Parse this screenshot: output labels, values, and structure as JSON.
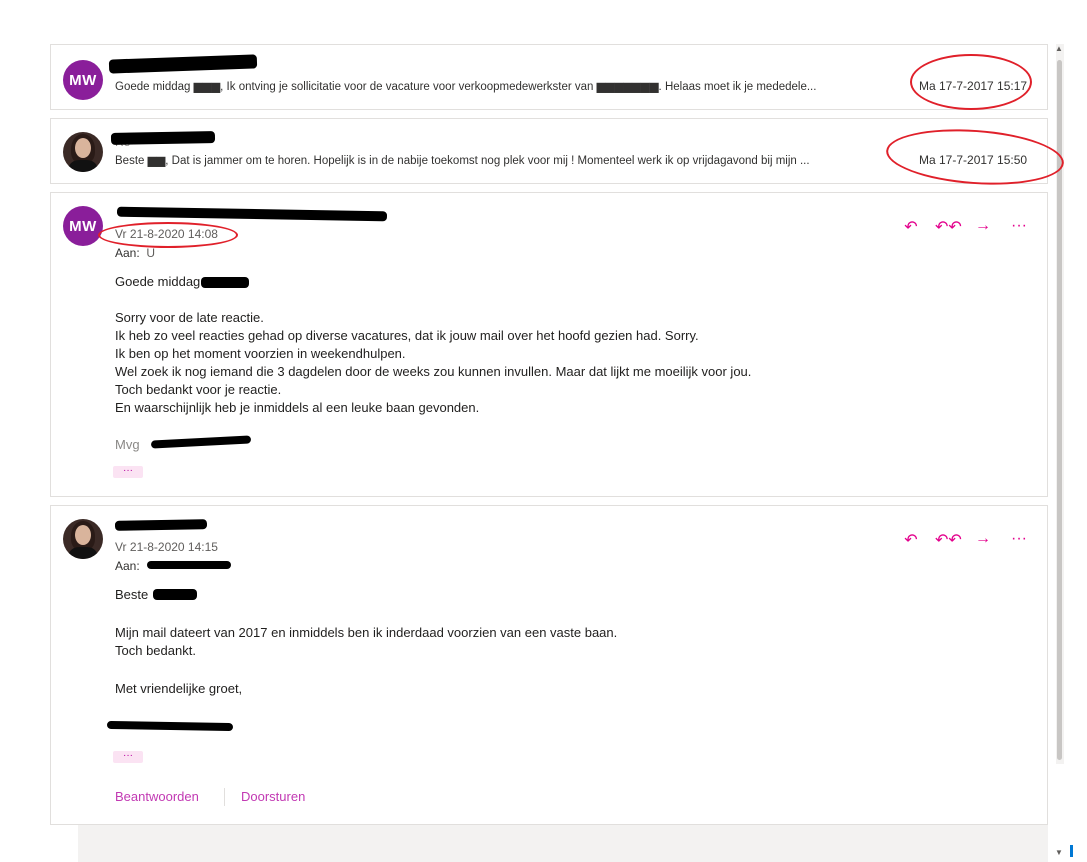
{
  "thread": [
    {
      "initials": "MW",
      "preview": "Goede middag ▆▆▆, Ik ontving je sollicitatie voor de vacature voor verkoopmedewerkster van ▆▆▆▆▆▆▆. Helaas moet ik je mededele...",
      "date": "Ma 17-7-2017 15:17"
    },
    {
      "sender_partial": "Re",
      "preview": "Beste ▆▆, Dat is jammer om te horen. Hopelijk is in de nabije toekomst nog plek voor mij ! Momenteel werk ik op vrijdagavond bij mijn ...",
      "date": "Ma 17-7-2017 15:50"
    },
    {
      "initials": "MW",
      "date": "Vr 21-8-2020 14:08",
      "to_label": "Aan:",
      "to_value": "U",
      "greeting": "Goede middag",
      "body": [
        "Sorry voor de late reactie.",
        "Ik heb zo veel reacties gehad op diverse vacatures, dat ik jouw mail over het hoofd gezien had. Sorry.",
        "Ik ben op het moment voorzien in weekendhulpen.",
        "Wel zoek ik nog iemand die 3 dagdelen door de weeks zou kunnen invullen. Maar dat lijkt me moeilijk voor jou.",
        "Toch bedankt voor je reactie.",
        "En waarschijnlijk heb je inmiddels al een leuke baan gevonden."
      ],
      "signoff": "Mvg",
      "more": "···"
    },
    {
      "date": "Vr 21-8-2020 14:15",
      "to_label": "Aan:",
      "greeting": "Beste",
      "body": [
        "Mijn mail dateert van 2017 en inmiddels ben ik inderdaad voorzien van een vaste baan.",
        "Toch bedankt."
      ],
      "closing": "Met vriendelijke groet,",
      "more": "···"
    }
  ],
  "actions": {
    "reply_icon": "↶",
    "reply_all_icon": "↶↶",
    "forward_icon": "→",
    "more_icon": "···"
  },
  "footer": {
    "reply": "Beantwoorden",
    "forward": "Doorsturen"
  },
  "colors": {
    "accent": "#e3008c",
    "avatar_mw": "#8a1e9a",
    "annotation": "#e0202a"
  }
}
